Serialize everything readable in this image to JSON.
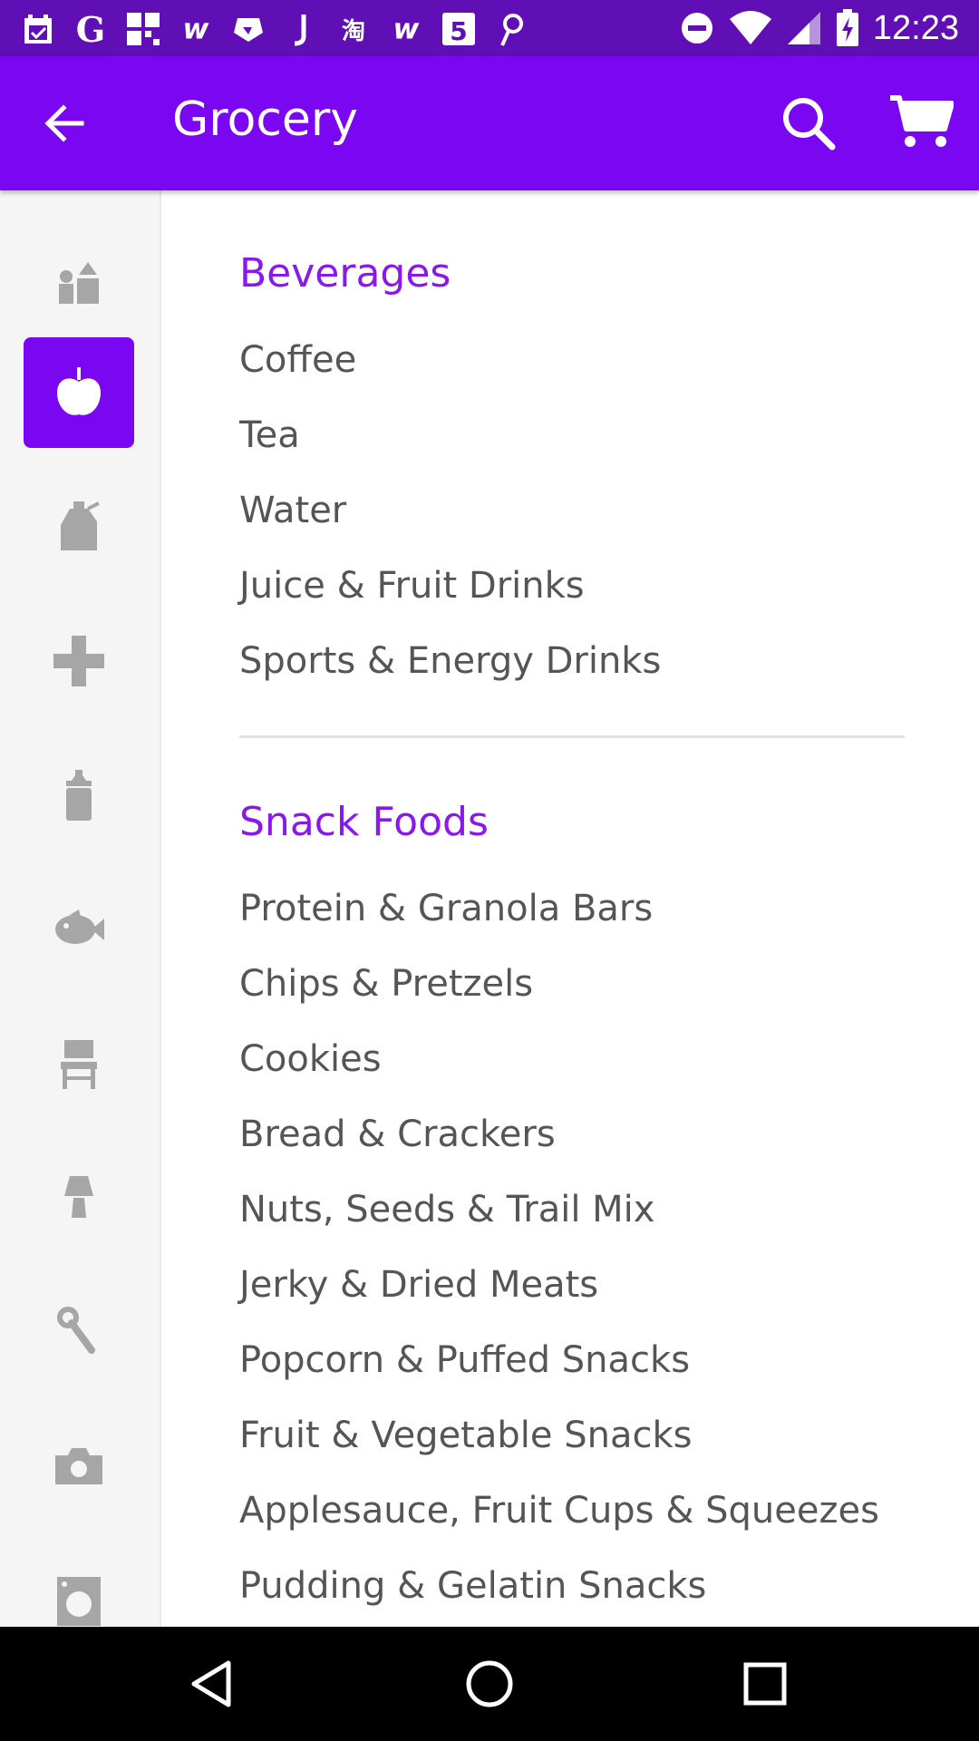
{
  "status_bar": {
    "time": "12:23",
    "left_icons": [
      "calendar-icon",
      "g-icon",
      "grid-icon",
      "w-icon",
      "shield-icon",
      "j-icon",
      "taobao-icon",
      "w-icon",
      "html5-icon",
      "pinterest-icon"
    ],
    "right_icons": [
      "dnd-icon",
      "wifi-icon",
      "signal-icon",
      "battery-charging-icon"
    ]
  },
  "app_bar": {
    "title": "Grocery",
    "back_icon": "arrow-back-icon",
    "search_icon": "search-icon",
    "cart_icon": "cart-icon",
    "color": "#7a06f2"
  },
  "sidebar": {
    "items": [
      {
        "icon": "toys-icon",
        "active": false
      },
      {
        "icon": "apple-icon",
        "active": true
      },
      {
        "icon": "bottle-icon",
        "active": false
      },
      {
        "icon": "health-plus-icon",
        "active": false
      },
      {
        "icon": "baby-bottle-icon",
        "active": false
      },
      {
        "icon": "pet-fish-icon",
        "active": false
      },
      {
        "icon": "chair-icon",
        "active": false
      },
      {
        "icon": "lamp-icon",
        "active": false
      },
      {
        "icon": "wrench-icon",
        "active": false
      },
      {
        "icon": "camera-icon",
        "active": false
      },
      {
        "icon": "washer-icon",
        "active": false
      }
    ]
  },
  "sections": [
    {
      "title": "Beverages",
      "items": [
        "Coffee",
        "Tea",
        "Water",
        "Juice & Fruit Drinks",
        "Sports & Energy Drinks"
      ]
    },
    {
      "title": "Snack Foods",
      "items": [
        "Protein & Granola Bars",
        "Chips & Pretzels",
        "Cookies",
        "Bread & Crackers",
        "Nuts, Seeds & Trail Mix",
        "Jerky & Dried Meats",
        "Popcorn & Puffed Snacks",
        "Fruit & Vegetable Snacks",
        "Applesauce, Fruit Cups & Squeezes",
        "Pudding & Gelatin Snacks"
      ]
    }
  ],
  "colors": {
    "accent": "#7a06f2",
    "status_bar": "#5f0fb5",
    "section_title": "#8a18ee",
    "item_text": "#555555",
    "sidebar_icon": "#a6a6a6"
  },
  "nav_bar": {
    "buttons": [
      "back-triangle-icon",
      "home-circle-icon",
      "recents-square-icon"
    ]
  }
}
